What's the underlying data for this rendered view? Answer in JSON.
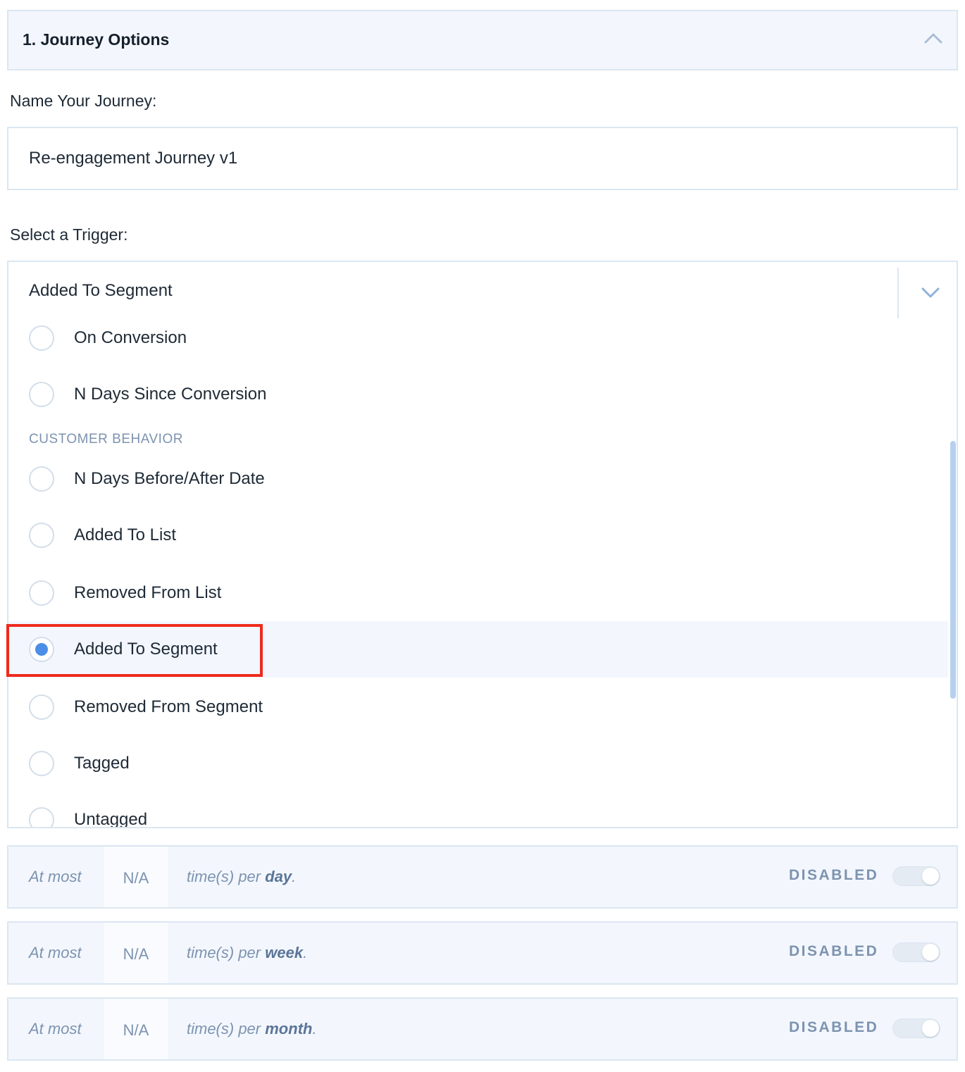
{
  "section": {
    "title": "1. Journey Options",
    "collapse_icon": "chevron-up-icon"
  },
  "name_field": {
    "label": "Name Your Journey:",
    "value": "Re-engagement Journey v1"
  },
  "trigger": {
    "label": "Select a Trigger:",
    "selected_value": "Added To Segment",
    "dropdown_icon": "chevron-down-icon",
    "options_top": [
      {
        "label": "On Conversion",
        "checked": false
      },
      {
        "label": "N Days Since Conversion",
        "checked": false
      }
    ],
    "group_heading": "CUSTOMER BEHAVIOR",
    "options_behavior": [
      {
        "label": "N Days Before/After Date",
        "checked": false
      },
      {
        "label": "Added To List",
        "checked": false
      },
      {
        "label": "Removed From List",
        "checked": false
      },
      {
        "label": "Added To Segment",
        "checked": true
      },
      {
        "label": "Removed From Segment",
        "checked": false
      },
      {
        "label": "Tagged",
        "checked": false
      },
      {
        "label": "Untagged",
        "checked": false
      }
    ]
  },
  "frequency_limits": [
    {
      "prefix": "At most",
      "value": "N/A",
      "text": "time(s) per",
      "period": "day",
      "suffix": ".",
      "status": "DISABLED",
      "enabled": false
    },
    {
      "prefix": "At most",
      "value": "N/A",
      "text": "time(s) per",
      "period": "week",
      "suffix": ".",
      "status": "DISABLED",
      "enabled": false
    },
    {
      "prefix": "At most",
      "value": "N/A",
      "text": "time(s) per",
      "period": "month",
      "suffix": ".",
      "status": "DISABLED",
      "enabled": false
    }
  ],
  "colors": {
    "accent": "#4a8ee8",
    "highlight_border": "#ee2a1c",
    "panel_bg": "#f3f7fd",
    "border": "#dbe6f2",
    "muted_text": "#7d93b0"
  }
}
